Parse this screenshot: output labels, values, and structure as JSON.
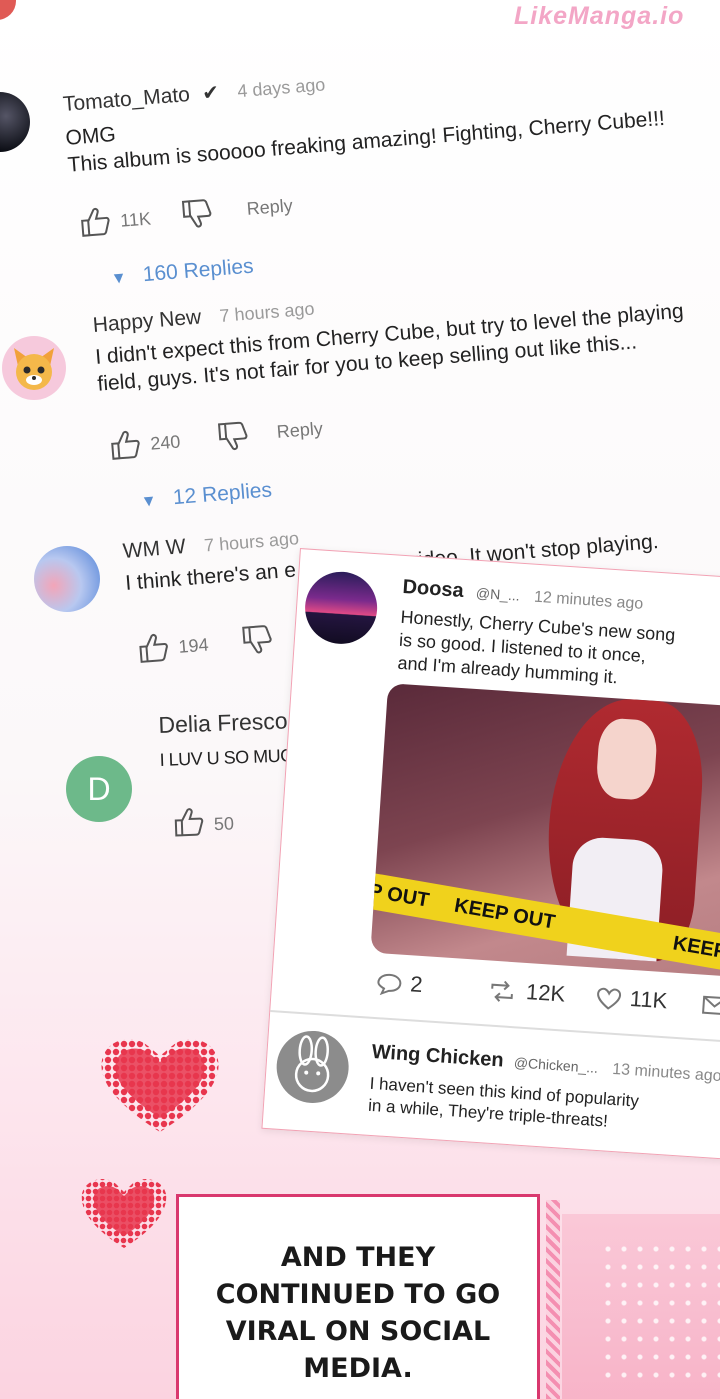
{
  "watermark": "LikeManga.io",
  "comments": [
    {
      "user": "Tomato_Mato",
      "verified": true,
      "time": "4 days ago",
      "lines": [
        "OMG",
        "This album is sooooo freaking amazing! Fighting, Cherry Cube!!!"
      ],
      "likes": "11K",
      "reply": "Reply",
      "replies": "160 Replies"
    },
    {
      "user": "Happy New",
      "time": "7 hours ago",
      "lines": [
        "I didn't expect this from Cherry Cube, but try to level the playing",
        "field, guys. It's not fair for you to keep selling out like this..."
      ],
      "likes": "240",
      "reply": "Reply",
      "replies": "12 Replies"
    },
    {
      "user": "WM W",
      "time": "7 hours ago",
      "lines": [
        "I think there's an e",
        "with the video. It won't stop playing."
      ],
      "likes": "194"
    },
    {
      "user": "Delia Fresco",
      "avatar_letter": "D",
      "lines": [
        "I LUV U SO MUC"
      ],
      "likes": "50"
    }
  ],
  "post": {
    "user": "Doosa",
    "handle": "@N_...",
    "time": "12 minutes ago",
    "lines": [
      "Honestly, Cherry Cube's new song",
      "is so good. I listened to it once,",
      "and I'm already humming it."
    ],
    "tape": [
      "EP OUT",
      "KEEP OUT",
      "KEEP OUT"
    ],
    "comments_count": "2",
    "reposts": "12K",
    "likes": "11K"
  },
  "reply_post": {
    "user": "Wing Chicken",
    "handle": "@Chicken_...",
    "time": "13 minutes ago",
    "lines": [
      "I haven't seen this kind of popularity",
      "in a while, They're triple-threats!"
    ]
  },
  "caption": [
    "AND THEY",
    "CONTINUED TO GO",
    "VIRAL ON SOCIAL",
    "MEDIA."
  ],
  "colors": {
    "accent": "#5a8fd0",
    "border": "#f2a2b4",
    "heart": "#e8364e"
  }
}
